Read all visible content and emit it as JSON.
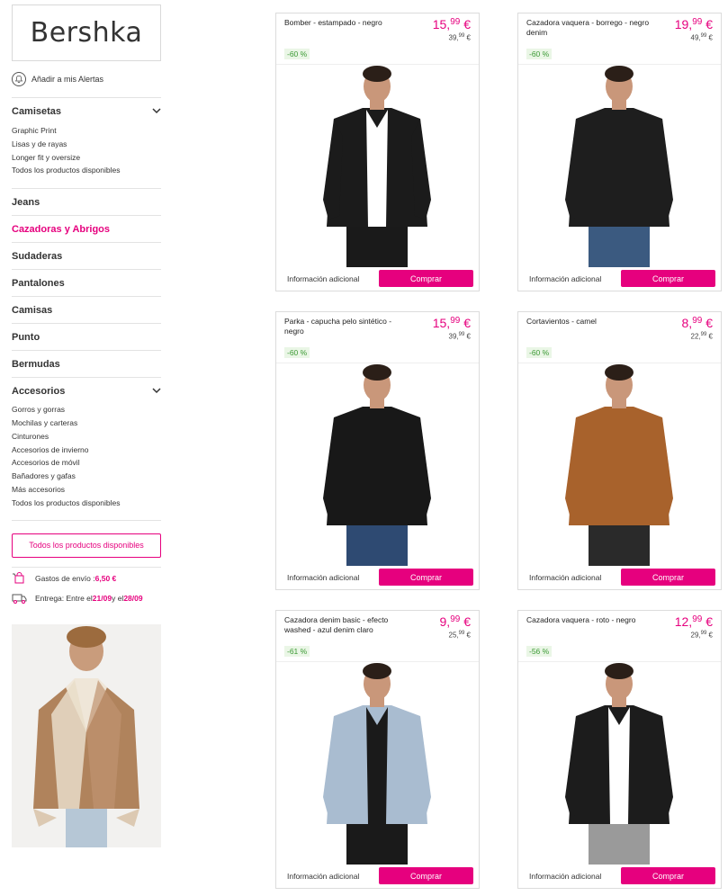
{
  "brand": "Bershka",
  "alerts_label": "Añadir a mis Alertas",
  "sidebar": {
    "camisetas": {
      "label": "Camisetas",
      "items": [
        "Graphic Print",
        "Lisas y de rayas",
        "Longer fit y oversize",
        "Todos los productos disponibles"
      ]
    },
    "jeans": "Jeans",
    "cazadoras": "Cazadoras y Abrigos",
    "sudaderas": "Sudaderas",
    "pantalones": "Pantalones",
    "camisas": "Camisas",
    "punto": "Punto",
    "bermudas": "Bermudas",
    "accesorios": {
      "label": "Accesorios",
      "items": [
        "Gorros y gorras",
        "Mochilas y carteras",
        "Cinturones",
        "Accesorios de invierno",
        "Accesorios de móvil",
        "Bañadores y gafas",
        "Más accesorios",
        "Todos los productos disponibles"
      ]
    },
    "all_products_button": "Todos los productos disponibles",
    "shipping": {
      "label": "Gastos de envío : ",
      "value": "6,50 €"
    },
    "delivery": {
      "label_a": "Entrega: Entre el ",
      "date_a": "21/09",
      "label_b": " y el ",
      "date_b": "28/09"
    }
  },
  "products": [
    {
      "name": "Bomber - estampado - negro",
      "price_int": "15,",
      "price_cents": "99",
      "price_cur": " €",
      "old_int": "39,",
      "old_cents": "99",
      "old_cur": " €",
      "discount": "-60 %",
      "jacket_color": "#1b1b1b",
      "shirt_color": "#ffffff",
      "pants_color": "#1a1a1a"
    },
    {
      "name": "Cazadora vaquera - borrego - negro denim",
      "price_int": "19,",
      "price_cents": "99",
      "price_cur": " €",
      "old_int": "49,",
      "old_cents": "99",
      "old_cur": " €",
      "discount": "-60 %",
      "jacket_color": "#1e1e1e",
      "shirt_color": "#1e1e1e",
      "pants_color": "#3b5a80"
    },
    {
      "name": "Parka - capucha pelo sintético - negro",
      "price_int": "15,",
      "price_cents": "99",
      "price_cur": " €",
      "old_int": "39,",
      "old_cents": "99",
      "old_cur": " €",
      "discount": "-60 %",
      "jacket_color": "#181818",
      "shirt_color": "#181818",
      "pants_color": "#2e4a72"
    },
    {
      "name": "Cortavientos - camel",
      "price_int": "8,",
      "price_cents": "99",
      "price_cur": " €",
      "old_int": "22,",
      "old_cents": "99",
      "old_cur": " €",
      "discount": "-60 %",
      "jacket_color": "#a8622c",
      "shirt_color": "#a8622c",
      "pants_color": "#2a2a2a"
    },
    {
      "name": "Cazadora denim basic - efecto washed - azul denim claro",
      "price_int": "9,",
      "price_cents": "99",
      "price_cur": " €",
      "old_int": "25,",
      "old_cents": "99",
      "old_cur": " €",
      "discount": "-61 %",
      "jacket_color": "#a9bcd0",
      "shirt_color": "#1a1a1a",
      "pants_color": "#1a1a1a"
    },
    {
      "name": "Cazadora vaquera - roto - negro",
      "price_int": "12,",
      "price_cents": "99",
      "price_cur": " €",
      "old_int": "29,",
      "old_cents": "99",
      "old_cur": " €",
      "discount": "-56 %",
      "jacket_color": "#1c1c1c",
      "shirt_color": "#ffffff",
      "pants_color": "#9a9a9a"
    }
  ],
  "info_label": "Información adicional",
  "buy_label": "Comprar"
}
